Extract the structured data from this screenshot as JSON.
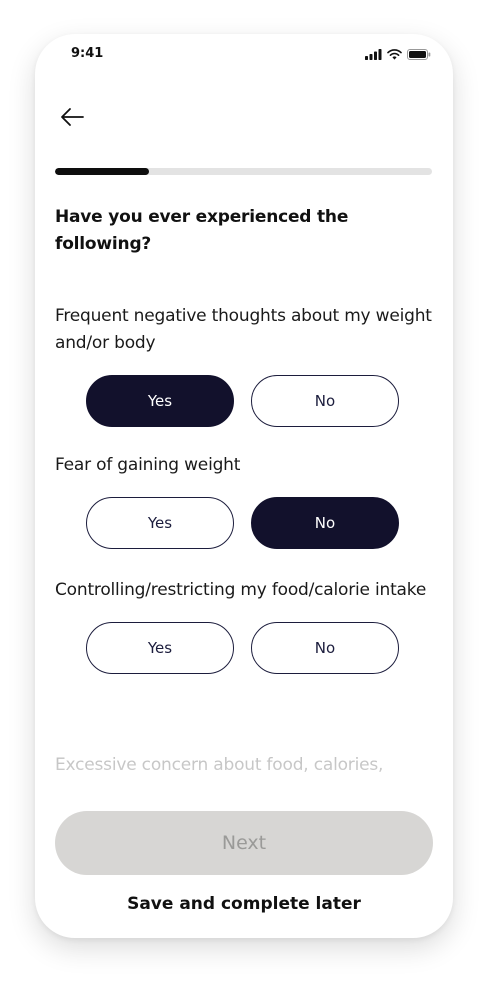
{
  "status_bar": {
    "time": "9:41",
    "icons": [
      "cellular-signal-icon",
      "wifi-icon",
      "battery-icon"
    ]
  },
  "header": {
    "back_icon": "arrow-left-icon"
  },
  "progress": {
    "fraction": 0.25
  },
  "question": {
    "title": "Have you ever experienced the following?"
  },
  "items": [
    {
      "label": "Frequent negative thoughts about my weight and/or body",
      "yes": "Yes",
      "no": "No",
      "selected": "yes"
    },
    {
      "label": "Fear of gaining weight",
      "yes": "Yes",
      "no": "No",
      "selected": "no"
    },
    {
      "label": "Controlling/restricting my food/calorie intake",
      "yes": "Yes",
      "no": "No",
      "selected": null
    }
  ],
  "next_item_preview": "Excessive concern about food, calories,",
  "footer": {
    "next_label": "Next",
    "save_later_label": "Save and complete later"
  },
  "colors": {
    "selected_bg": "#12112c",
    "outline": "#1c1d3d",
    "next_disabled_bg": "#d7d6d4",
    "progress_fill": "#0e0e0e",
    "progress_track": "#e3e3e3"
  }
}
